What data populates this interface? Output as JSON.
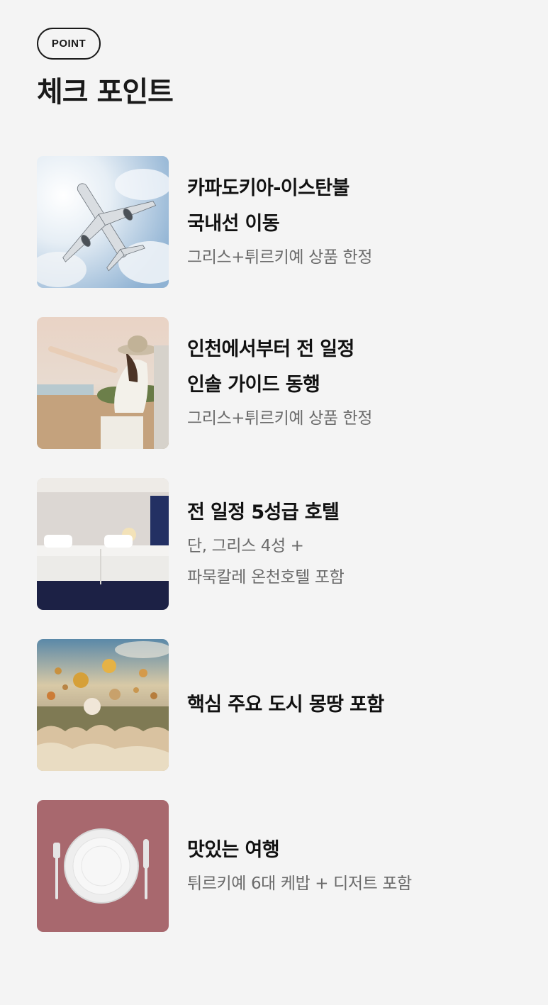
{
  "badge": "POINT",
  "section_title": "체크 포인트",
  "items": [
    {
      "image": "airplane-photo",
      "title_lines": [
        "카파도키아-이스탄불",
        "국내선 이동"
      ],
      "desc_lines": [
        "그리스+튀르키예 상품 한정"
      ]
    },
    {
      "image": "guide-photo",
      "title_lines": [
        "인천에서부터 전 일정",
        "인솔 가이드 동행"
      ],
      "desc_lines": [
        "그리스+튀르키예 상품 한정"
      ]
    },
    {
      "image": "hotel-room-photo",
      "title_lines": [
        "전 일정 5성급 호텔"
      ],
      "desc_lines": [
        "단, 그리스 4성 +",
        "파묵칼레 온천호텔 포함"
      ]
    },
    {
      "image": "balloons-photo",
      "title_lines": [
        "핵심 주요 도시 몽땅 포함"
      ],
      "desc_lines": []
    },
    {
      "image": "dinner-plate-photo",
      "title_lines": [
        "맛있는 여행"
      ],
      "desc_lines": [
        "튀르키예 6대 케밥 + 디저트 포함"
      ]
    }
  ]
}
